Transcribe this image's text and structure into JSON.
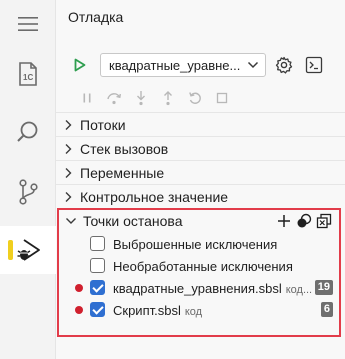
{
  "panel": {
    "title": "Отладка"
  },
  "toolbar": {
    "config_value": "квадратные_уравне..."
  },
  "sections": [
    {
      "label": "Потоки"
    },
    {
      "label": "Стек вызовов"
    },
    {
      "label": "Переменные"
    },
    {
      "label": "Контрольное значение"
    }
  ],
  "breakpoints": {
    "title": "Точки останова",
    "items": [
      {
        "label": "Выброшенные исключения",
        "checked": false,
        "has_dot": false
      },
      {
        "label": "Необработанные исключения",
        "checked": false,
        "has_dot": false
      },
      {
        "label": "квадратные_уравнения.sbsl",
        "sub": "код...",
        "checked": true,
        "has_dot": true,
        "count": "19"
      },
      {
        "label": "Скрипт.sbsl",
        "sub": "код",
        "checked": true,
        "has_dot": true,
        "count": "6"
      }
    ]
  },
  "colors": {
    "accent_blue": "#2f6fd1",
    "breakpoint_red": "#d0202e",
    "highlight_border": "#e23c4a",
    "run_green": "#2e9e4f",
    "active_indicator": "#f0cf1f"
  }
}
